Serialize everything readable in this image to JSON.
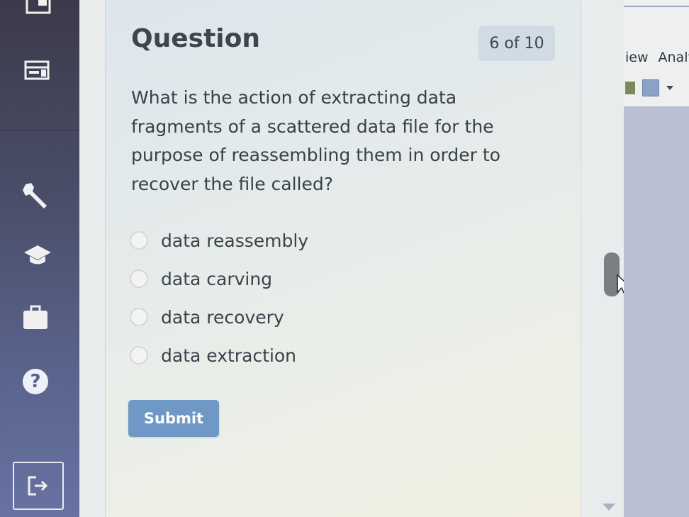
{
  "quiz": {
    "title": "Question",
    "progress": "6 of 10",
    "question": "What is the action of extracting data fragments of a scattered data file for the purpose of reassembling them in order to recover the file called?",
    "options": [
      {
        "label": "data reassembly",
        "selected": false
      },
      {
        "label": "data carving",
        "selected": false
      },
      {
        "label": "data recovery",
        "selected": false
      },
      {
        "label": "data extraction",
        "selected": false
      }
    ],
    "submit_label": "Submit"
  },
  "sidebar": {
    "icons": [
      "layout-icon",
      "wrench-icon",
      "graduation-cap-icon",
      "briefcase-icon",
      "help-icon",
      "logout-icon"
    ]
  },
  "background_window": {
    "menu": [
      "iew",
      "Analy"
    ]
  },
  "colors": {
    "sidebar": "#4a4f6a",
    "submit": "#6f98c6",
    "badge": "#d0dbe4"
  }
}
